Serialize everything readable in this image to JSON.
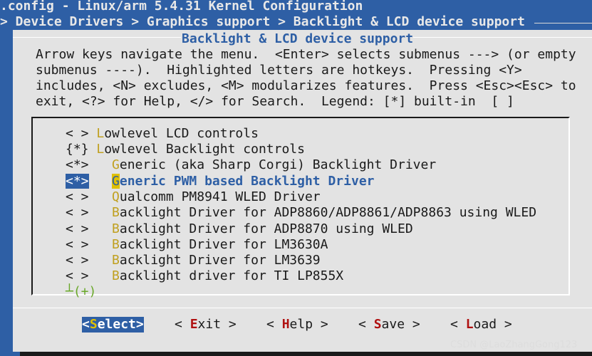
{
  "window": {
    "title": ".config - Linux/arm 5.4.31 Kernel Configuration",
    "breadcrumb": "> Device Drivers > Graphics support > Backlight & LCD device support"
  },
  "dialog": {
    "title": "Backlight & LCD device support",
    "help_lines": [
      "Arrow keys navigate the menu.  <Enter> selects submenus ---> (or empty",
      "submenus ----).  Highlighted letters are hotkeys.  Pressing <Y>",
      "includes, <N> excludes, <M> modularizes features.  Press <Esc><Esc> to",
      "exit, <?> for Help, </> for Search.  Legend: [*] built-in  [ ]"
    ]
  },
  "menu": {
    "items": [
      {
        "tag": "< > ",
        "hot": "L",
        "rest": "owlevel LCD controls"
      },
      {
        "tag": "{*} ",
        "hot": "L",
        "rest": "owlevel Backlight controls"
      },
      {
        "tag": "<*>   ",
        "hot": "G",
        "rest": "eneric (aka Sharp Corgi) Backlight Driver"
      },
      {
        "tag": "<*>",
        "gap": "   ",
        "hot": "G",
        "rest": "eneric PWM based Backlight Driver"
      },
      {
        "tag": "< >   ",
        "hot": "Q",
        "rest": "ualcomm PM8941 WLED Driver"
      },
      {
        "tag": "< >   ",
        "hot": "B",
        "rest": "acklight Driver for ADP8860/ADP8861/ADP8863 using WLED"
      },
      {
        "tag": "< >   ",
        "hot": "B",
        "rest": "acklight Driver for ADP8870 using WLED"
      },
      {
        "tag": "< >   ",
        "hot": "B",
        "rest": "acklight Driver for LM3630A"
      },
      {
        "tag": "< >   ",
        "hot": "B",
        "rest": "acklight Driver for LM3639"
      },
      {
        "tag": "< >   ",
        "hot": "B",
        "rest": "acklight driver for TI LP855X"
      }
    ],
    "more_indicator": "┴(+)"
  },
  "buttons": {
    "select": {
      "pre": "<",
      "hot": "S",
      "post": "elect>"
    },
    "exit": {
      "pre": "< ",
      "hot": "E",
      "post": "xit >"
    },
    "help": {
      "pre": "< ",
      "hot": "H",
      "post": "elp >"
    },
    "save": {
      "pre": "< ",
      "hot": "S",
      "post": "ave >"
    },
    "load": {
      "pre": "< ",
      "hot": "L",
      "post": "oad >"
    }
  },
  "watermark": "CSDN @LaoZhangGong123",
  "colors": {
    "background": "#2e5fa5",
    "dialog": "#e3e3e3",
    "hotkey": "#c0a020",
    "button_hotkey": "#b01010"
  }
}
